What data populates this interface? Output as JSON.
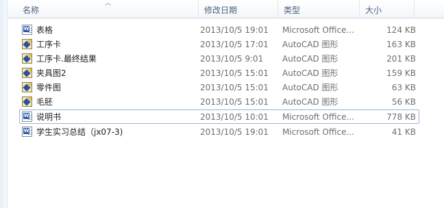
{
  "columns": {
    "name": "名称",
    "date": "修改日期",
    "type": "类型",
    "size": "大小"
  },
  "files": [
    {
      "name": "表格",
      "date": "2013/10/5 19:01",
      "type": "Microsoft Office...",
      "size": "124 KB",
      "icon": "word-document-icon"
    },
    {
      "name": "工序卡",
      "date": "2013/10/5 17:01",
      "type": "AutoCAD 图形",
      "size": "163 KB",
      "icon": "autocad-drawing-icon"
    },
    {
      "name": "工序卡.最终结果",
      "date": "2013/10/5 9:01",
      "type": "AutoCAD 图形",
      "size": "201 KB",
      "icon": "autocad-drawing-icon"
    },
    {
      "name": "夹具图2",
      "date": "2013/10/5 15:01",
      "type": "AutoCAD 图形",
      "size": "159 KB",
      "icon": "autocad-drawing-icon"
    },
    {
      "name": "零件图",
      "date": "2013/10/5 15:01",
      "type": "AutoCAD 图形",
      "size": "63 KB",
      "icon": "autocad-drawing-icon"
    },
    {
      "name": "毛胚",
      "date": "2013/10/5 15:01",
      "type": "AutoCAD 图形",
      "size": "56 KB",
      "icon": "autocad-drawing-icon"
    },
    {
      "name": "说明书",
      "date": "2013/10/5 10:01",
      "type": "Microsoft Office...",
      "size": "778 KB",
      "icon": "word-document-icon"
    },
    {
      "name": "学生实习总结（jx07-3)",
      "date": "2013/10/5 19:01",
      "type": "Microsoft Office...",
      "size": "41 KB",
      "icon": "word-document-icon"
    }
  ],
  "colors": {
    "header_text": "#4c607a",
    "secondary_text": "#6d6d6d",
    "focus_border": "#9ab3cf"
  }
}
